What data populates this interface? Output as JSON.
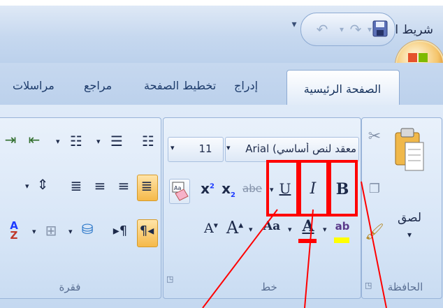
{
  "caption_top": "",
  "title_bar": {
    "text": "شريط العنوان - d"
  },
  "tabs": {
    "home": "الصفحة الرئيسية",
    "insert": "إدراج",
    "page_layout": "تخطيط الصفحة",
    "references": "مراجع",
    "mailings": "مراسلات"
  },
  "clipboard": {
    "paste_label": "لصق",
    "group_label": "الحافظة"
  },
  "font": {
    "font_name": "معقد لنص أساسي) Arial",
    "font_size": "11",
    "group_label": "خط",
    "bold": "B",
    "italic": "I",
    "underline": "U",
    "strike": "abe",
    "subscript": "x",
    "superscript": "x",
    "change_case": "Aa",
    "grow": "A",
    "shrink": "A",
    "color_letter": "A",
    "highlight_letters": "ab"
  },
  "paragraph": {
    "group_label": "فقرة"
  },
  "colors": {
    "annotation": "#ff0000",
    "font_color_bar": "#ff0000",
    "highlight_bar": "#ffff00"
  }
}
